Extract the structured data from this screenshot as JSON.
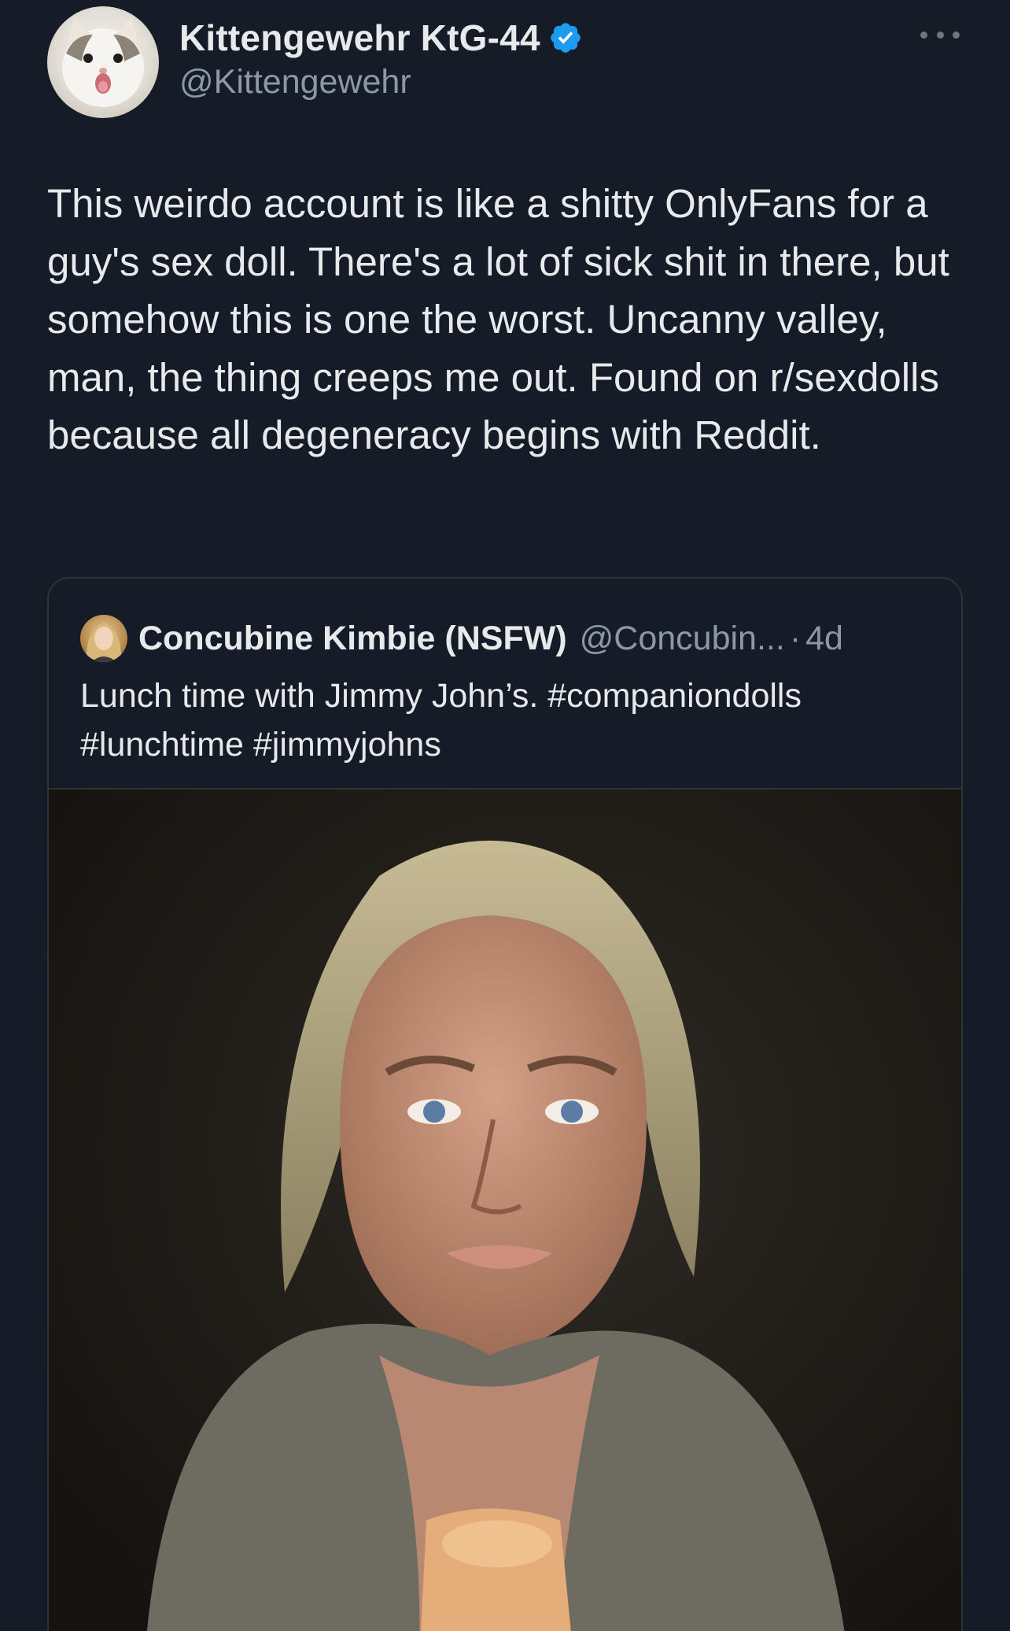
{
  "author": {
    "name": "Kittengewehr KtG-44",
    "handle": "@Kittengewehr",
    "verified": true,
    "avatar_icon": "cat-avatar-icon"
  },
  "tweet": {
    "text": "This weirdo account is like a shitty OnlyFans for a guy's sex doll. There's a lot of sick shit in there, but somehow this is one the worst. Uncanny valley, man, the thing creeps me out. Found on r/sexdolls because all degeneracy begins with Reddit."
  },
  "quoted": {
    "name": "Concubine Kimbie (NSFW)",
    "handle": "@Concubin...",
    "separator": "·",
    "time": "4d",
    "text": "Lunch time with Jimmy John’s. #companiondolls #lunchtime #jimmyjohns",
    "media_icon": "doll-photo-icon"
  },
  "colors": {
    "background": "#151c28",
    "text": "#e7e9ea",
    "secondary_text": "#8b98a5",
    "verified_blue": "#1d9bf0",
    "border": "#2f3336"
  }
}
